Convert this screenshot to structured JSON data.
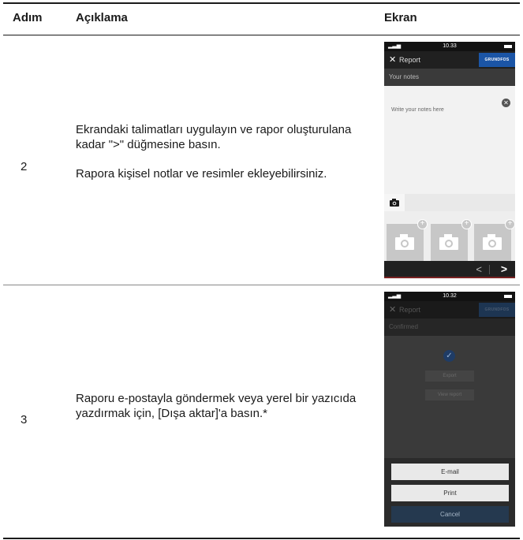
{
  "table": {
    "headers": [
      "Adım",
      "Açıklama",
      "Ekran"
    ],
    "rows": [
      {
        "step": "2",
        "description": [
          "Ekrandaki talimatları uygulayın ve rapor oluşturulana kadar \">\" düğmesine basın.",
          "Rapora kişisel notlar ve resimler ekleyebilirsiniz."
        ]
      },
      {
        "step": "3",
        "description": [
          "Raporu e-postayla göndermek veya yerel bir yazıcıda yazdırmak için, [Dışa aktar]'a basın.*"
        ]
      }
    ]
  },
  "screen1": {
    "time": "10.33",
    "title": "Report",
    "logo": "GRUNDFOS",
    "section": "Your notes",
    "notes_placeholder": "Write your notes here",
    "icons": [
      "close-icon",
      "clear-icon",
      "camera-icon",
      "add-icon",
      "prev-icon",
      "next-icon"
    ]
  },
  "screen2": {
    "time": "10.32",
    "title": "Report",
    "logo": "GRUNDFOS",
    "section": "Confirmed",
    "export_label": "Export",
    "view_report_label": "View report",
    "sheet": [
      "E-mail",
      "Print",
      "Cancel"
    ]
  },
  "colors": {
    "appbar": "#202020",
    "logo_blue": "#1b55a6",
    "thumb_gray": "#c7c7c7",
    "cancel_blue": "#25394f"
  }
}
